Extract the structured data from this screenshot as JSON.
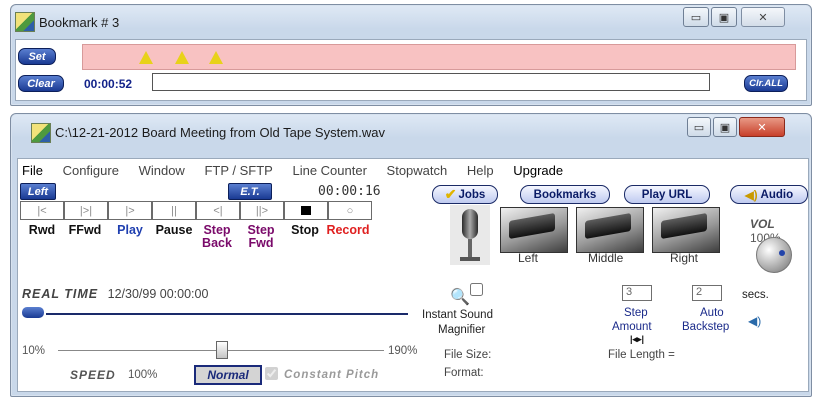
{
  "bookmark_window": {
    "title": "Bookmark # 3",
    "set_button": "Set",
    "clear_button": "Clear",
    "time": "00:00:52",
    "note_value": "",
    "clear_all_button": "Clr.ALL",
    "marker_count": 3,
    "bar_color": "#f8c2c2"
  },
  "main_window": {
    "title": "C:\\12-21-2012 Board Meeting from Old Tape System.wav",
    "menu": [
      "File",
      "Configure",
      "Window",
      "FTP / SFTP",
      "Line Counter",
      "Stopwatch",
      "Help",
      "Upgrade"
    ],
    "left_label": "Left",
    "et_label": "E.T.",
    "elapsed": "00:00:16",
    "transport": [
      {
        "label": "Rwd",
        "color": "#000000"
      },
      {
        "label": "FFwd",
        "color": "#000000"
      },
      {
        "label": "Play",
        "color": "#1f3fb0"
      },
      {
        "label": "Pause",
        "color": "#000000"
      },
      {
        "label": "Step Back",
        "color": "#7a0a6a"
      },
      {
        "label": "Step Fwd",
        "color": "#7a0a6a"
      },
      {
        "label": "Stop",
        "color": "#000000"
      },
      {
        "label": "Record",
        "color": "#e02020"
      }
    ],
    "toolbar": {
      "jobs": "Jobs",
      "bookmarks": "Bookmarks",
      "play_url": "Play URL",
      "audio": "Audio"
    },
    "pedals": {
      "left": "Left",
      "middle": "Middle",
      "right": "Right"
    },
    "vol_label": "VOL",
    "vol_value": "100%",
    "real_time_label": "REAL TIME",
    "real_time_value": "12/30/99  00:00:00",
    "magnifier_line1": "Instant Sound",
    "magnifier_line2": "Magnifier",
    "step_amount_value": "3",
    "auto_backstep_value": "2",
    "secs_label": "secs.",
    "step_amount_label_1": "Step",
    "step_amount_label_2": "Amount",
    "auto_backstep_label_1": "Auto",
    "auto_backstep_label_2": "Backstep",
    "speed_min": "10%",
    "speed_max": "190%",
    "speed_fraction": 0.5,
    "speed_label": "SPEED",
    "speed_value": "100%",
    "normal_button": "Normal",
    "constant_pitch": "Constant Pitch",
    "file_size_label": "File Size:",
    "format_label": "Format:",
    "file_length_label": "File Length ="
  }
}
